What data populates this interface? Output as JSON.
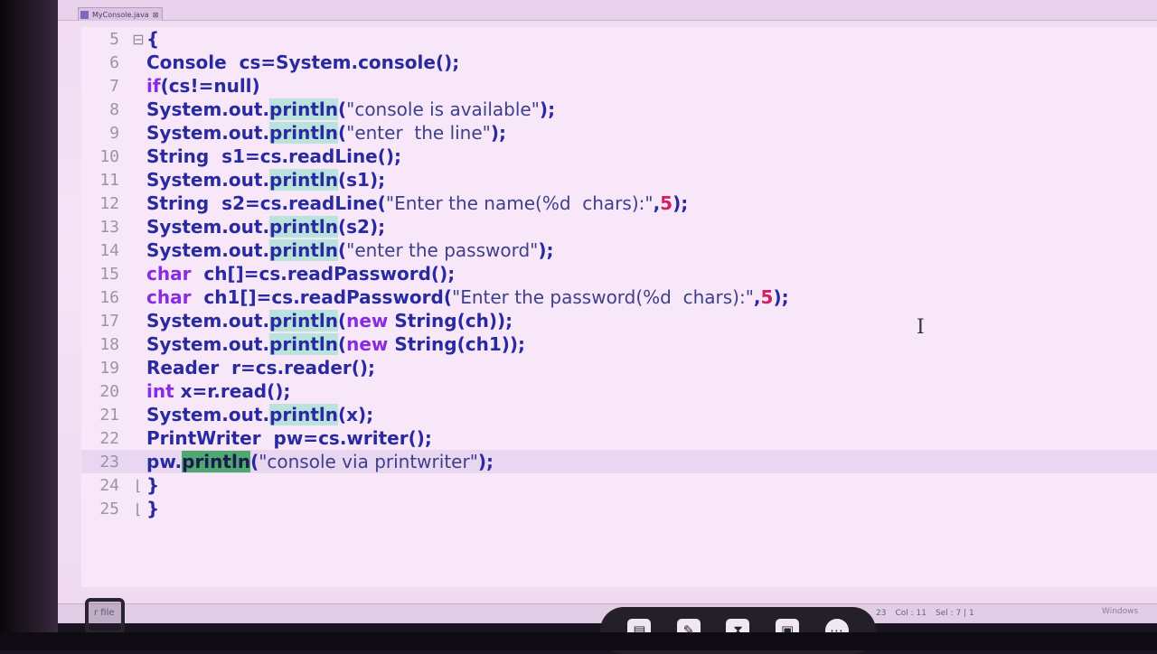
{
  "editor": {
    "tab_label": "MyConsole.java",
    "lines": [
      {
        "n": "5",
        "fold": "⊟",
        "parts": [
          [
            "t",
            "{"
          ]
        ]
      },
      {
        "n": "6",
        "parts": [
          [
            "t",
            "Console  cs=System.console();"
          ]
        ]
      },
      {
        "n": "7",
        "parts": [
          [
            "k",
            "if"
          ],
          [
            "t",
            "(cs!=null)"
          ]
        ]
      },
      {
        "n": "8",
        "parts": [
          [
            "t",
            "System.out."
          ],
          [
            "h",
            "println"
          ],
          [
            "t",
            "("
          ],
          [
            "s",
            "\"console is available\""
          ],
          [
            "t",
            ");"
          ]
        ]
      },
      {
        "n": "9",
        "parts": [
          [
            "t",
            "System.out."
          ],
          [
            "h",
            "println"
          ],
          [
            "t",
            "("
          ],
          [
            "s",
            "\"enter  the line\""
          ],
          [
            "t",
            ");"
          ]
        ]
      },
      {
        "n": "10",
        "parts": [
          [
            "t",
            "String  s1=cs.readLine();"
          ]
        ]
      },
      {
        "n": "11",
        "parts": [
          [
            "t",
            "System.out."
          ],
          [
            "h",
            "println"
          ],
          [
            "t",
            "(s1);"
          ]
        ]
      },
      {
        "n": "12",
        "parts": [
          [
            "t",
            "String  s2=cs.readLine("
          ],
          [
            "s",
            "\"Enter the name(%d  chars):\""
          ],
          [
            "t",
            ","
          ],
          [
            "n",
            "5"
          ],
          [
            "t",
            ");"
          ]
        ]
      },
      {
        "n": "13",
        "parts": [
          [
            "t",
            "System.out."
          ],
          [
            "h",
            "println"
          ],
          [
            "t",
            "(s2);"
          ]
        ]
      },
      {
        "n": "14",
        "parts": [
          [
            "t",
            "System.out."
          ],
          [
            "h",
            "println"
          ],
          [
            "t",
            "("
          ],
          [
            "s",
            "\"enter the password\""
          ],
          [
            "t",
            ");"
          ]
        ]
      },
      {
        "n": "15",
        "parts": [
          [
            "k",
            "char"
          ],
          [
            "t",
            "  ch[]=cs.readPassword();"
          ]
        ]
      },
      {
        "n": "16",
        "parts": [
          [
            "k",
            "char"
          ],
          [
            "t",
            "  ch1[]=cs.readPassword("
          ],
          [
            "s",
            "\"Enter the password(%d  chars):\""
          ],
          [
            "t",
            ","
          ],
          [
            "n",
            "5"
          ],
          [
            "t",
            ");"
          ]
        ]
      },
      {
        "n": "17",
        "parts": [
          [
            "t",
            "System.out."
          ],
          [
            "h",
            "println"
          ],
          [
            "t",
            "("
          ],
          [
            "k",
            "new"
          ],
          [
            "t",
            " String(ch));"
          ]
        ]
      },
      {
        "n": "18",
        "parts": [
          [
            "t",
            "System.out."
          ],
          [
            "h",
            "println"
          ],
          [
            "t",
            "("
          ],
          [
            "k",
            "new"
          ],
          [
            "t",
            " String(ch1));"
          ]
        ]
      },
      {
        "n": "19",
        "parts": [
          [
            "t",
            "Reader  r=cs.reader();"
          ]
        ]
      },
      {
        "n": "20",
        "parts": [
          [
            "k",
            "int"
          ],
          [
            "t",
            " x=r.read();"
          ]
        ]
      },
      {
        "n": "21",
        "parts": [
          [
            "t",
            "System.out."
          ],
          [
            "h",
            "println"
          ],
          [
            "t",
            "(x);"
          ]
        ]
      },
      {
        "n": "22",
        "parts": [
          [
            "t",
            "PrintWriter  pw=cs.writer();"
          ]
        ]
      },
      {
        "n": "23",
        "current": true,
        "parts": [
          [
            "t",
            "pw."
          ],
          [
            "H",
            "println"
          ],
          [
            "t",
            "("
          ],
          [
            "s",
            "\"console via printwriter\""
          ],
          [
            "t",
            ");"
          ]
        ]
      },
      {
        "n": "24",
        "fold": "⌊",
        "parts": [
          [
            "t",
            "}"
          ]
        ]
      },
      {
        "n": "25",
        "fold": "⌊",
        "parts": [
          [
            "t",
            "}"
          ]
        ]
      }
    ]
  },
  "status": {
    "left": "r file",
    "line": "23",
    "col": "Col : 11",
    "sel": "Sel : 7 | 1",
    "windows": "Windows"
  },
  "toolbar": {
    "icons": [
      "document-icon",
      "pen-icon",
      "hourglass-icon",
      "image-icon",
      "more-icon"
    ]
  }
}
